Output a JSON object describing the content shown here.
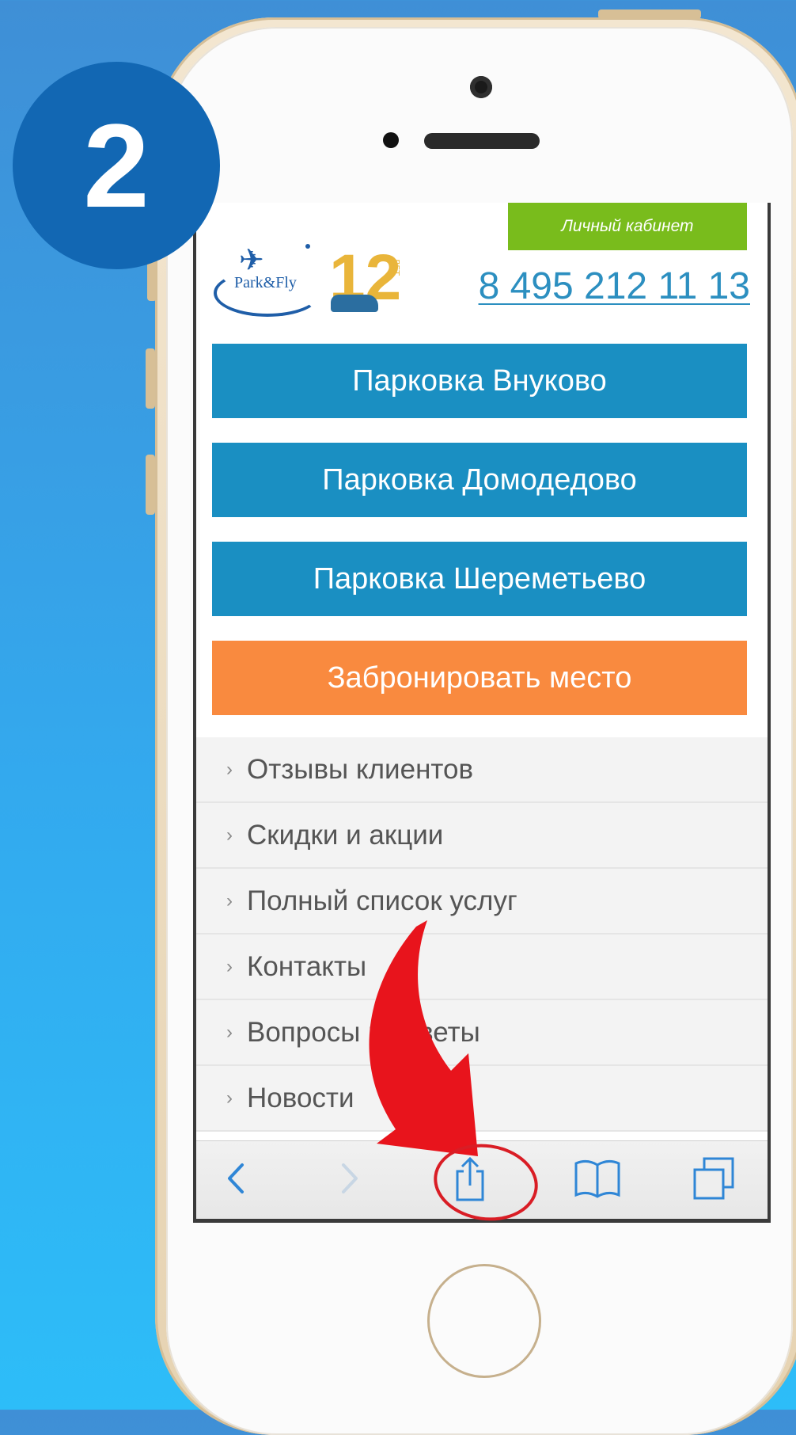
{
  "step": {
    "number": "2"
  },
  "site": {
    "logo_text": "Park&Fly",
    "anniversary_number": "12",
    "anniversary_suffix": "ЛЕТ",
    "cabinet_label": "Личный кабинет",
    "phone": "8 495 212 11 13"
  },
  "nav_buttons": [
    {
      "label": "Парковка Внуково"
    },
    {
      "label": "Парковка Домодедово"
    },
    {
      "label": "Парковка Шереметьево"
    },
    {
      "label": "Забронировать место"
    }
  ],
  "menu": [
    {
      "label": "Отзывы клиентов"
    },
    {
      "label": "Скидки и акции"
    },
    {
      "label": "Полный список услуг"
    },
    {
      "label": "Контакты"
    },
    {
      "label": "Вопросы и ответы"
    },
    {
      "label": "Новости"
    }
  ],
  "menu_chevron": "›",
  "toolbar": {
    "icons": [
      "back-icon",
      "forward-icon",
      "share-icon",
      "bookmarks-icon",
      "tabs-icon"
    ]
  },
  "colors": {
    "background_top": "#3f8fd6",
    "background_bottom": "#2dbdf8",
    "badge": "#1267b3",
    "nav_blue": "#1a8fc2",
    "nav_orange": "#f98a3f",
    "cabinet_green": "#79bc1c",
    "phone_link": "#2c8fc0",
    "arrow_red": "#e8141c",
    "toolbar_icon": "#2f86d6"
  }
}
